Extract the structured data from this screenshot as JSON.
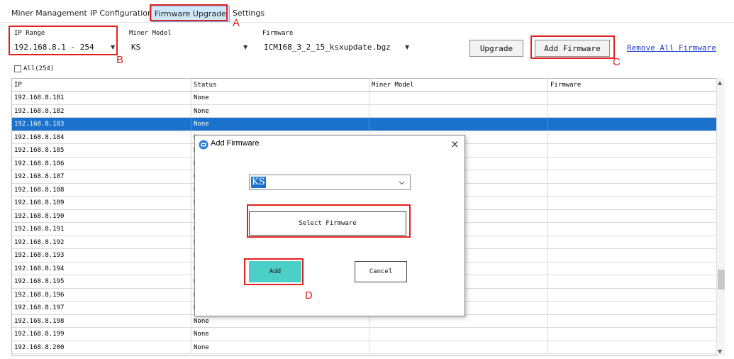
{
  "tabs": [
    {
      "label": "Miner Management",
      "active": false
    },
    {
      "label": "IP Configuration",
      "active": false
    },
    {
      "label": "Firmware Upgrade",
      "active": true
    },
    {
      "label": "Settings",
      "active": false
    }
  ],
  "toolbar": {
    "ip_range_label": "IP Range",
    "ip_range_value": "192.168.8.1 - 254",
    "miner_model_label": "Miner Model",
    "miner_model_value": "KS",
    "firmware_label": "Firmware",
    "firmware_value": "ICM168_3_2_15_ksxupdate.bgz",
    "upgrade_label": "Upgrade",
    "add_firmware_label": "Add Firmware",
    "remove_all_label": "Remove All Firmware",
    "select_all_label": "All(254)"
  },
  "annotations": {
    "a": "A",
    "b": "B",
    "c": "C",
    "d": "D"
  },
  "table": {
    "columns": [
      "IP",
      "Status",
      "Miner Model",
      "Firmware"
    ],
    "rows": [
      {
        "ip": "192.168.8.181",
        "status": "None"
      },
      {
        "ip": "192.168.8.182",
        "status": "None"
      },
      {
        "ip": "192.168.8.183",
        "status": "None"
      },
      {
        "ip": "192.168.8.184",
        "status": "N"
      },
      {
        "ip": "192.168.8.185",
        "status": "N"
      },
      {
        "ip": "192.168.8.186",
        "status": "N"
      },
      {
        "ip": "192.168.8.187",
        "status": "N"
      },
      {
        "ip": "192.168.8.188",
        "status": "N"
      },
      {
        "ip": "192.168.8.189",
        "status": "N"
      },
      {
        "ip": "192.168.8.190",
        "status": "N"
      },
      {
        "ip": "192.168.8.191",
        "status": "N"
      },
      {
        "ip": "192.168.8.192",
        "status": "N"
      },
      {
        "ip": "192.168.8.193",
        "status": "N"
      },
      {
        "ip": "192.168.8.194",
        "status": "N"
      },
      {
        "ip": "192.168.8.195",
        "status": "N"
      },
      {
        "ip": "192.168.8.196",
        "status": "N"
      },
      {
        "ip": "192.168.8.197",
        "status": "N"
      },
      {
        "ip": "192.168.8.198",
        "status": "None"
      },
      {
        "ip": "192.168.8.199",
        "status": "None"
      },
      {
        "ip": "192.168.8.200",
        "status": "None"
      }
    ],
    "selected_index": 2
  },
  "dialog": {
    "title": "Add Firmware",
    "close_glyph": "×",
    "model_value": "KS",
    "select_firmware_label": "Select Firmware",
    "add_label": "Add",
    "cancel_label": "Cancel"
  },
  "icons": {
    "dropdown": "chevron-down-icon",
    "app": "app-logo-icon",
    "close": "close-icon"
  },
  "colors": {
    "selected_row": "#1b72cc",
    "annotation": "#e0201f",
    "add_button": "#4ccfc7",
    "active_tab": "#cfe8fb"
  }
}
